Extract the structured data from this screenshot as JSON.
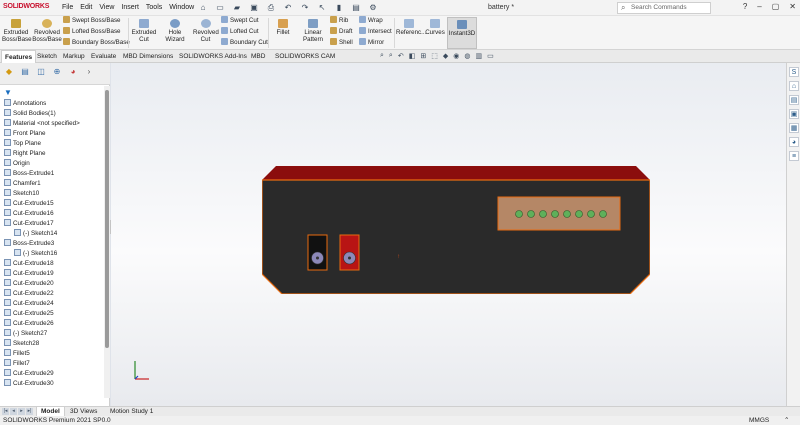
{
  "app": {
    "logo": "SOLIDWORKS",
    "document_title": "battery *"
  },
  "menu": [
    "File",
    "Edit",
    "View",
    "Insert",
    "Tools",
    "Window"
  ],
  "search": {
    "placeholder": "Search Commands"
  },
  "ribbon": {
    "extruded_boss": "Extruded Boss/Base",
    "revolved_boss": "Revolved Boss/Base",
    "swept_boss": "Swept Boss/Base",
    "lofted_boss": "Lofted Boss/Base",
    "boundary_boss": "Boundary Boss/Base",
    "extruded_cut": "Extruded Cut",
    "hole_wizard": "Hole Wizard",
    "revolved_cut": "Revolved Cut",
    "swept_cut": "Swept Cut",
    "lofted_cut": "Lofted Cut",
    "boundary_cut": "Boundary Cut",
    "fillet": "Fillet",
    "linear_pattern": "Linear Pattern",
    "rib": "Rib",
    "draft": "Draft",
    "shell": "Shell",
    "wrap": "Wrap",
    "intersect": "Intersect",
    "mirror": "Mirror",
    "reference": "Referenc...",
    "curves": "Curves",
    "instant3d": "Instant3D"
  },
  "command_tabs": [
    "Features",
    "Sketch",
    "Markup",
    "Evaluate",
    "MBD Dimensions",
    "SOLIDWORKS Add-Ins",
    "MBD",
    "SOLIDWORKS CAM"
  ],
  "feature_tree": [
    "Annotations",
    "Solid Bodies(1)",
    "Material <not specified>",
    "Front Plane",
    "Top Plane",
    "Right Plane",
    "Origin",
    "Boss-Extrude1",
    "Chamfer1",
    "Sketch10",
    "Cut-Extrude15",
    "Cut-Extrude16",
    "Cut-Extrude17",
    "(-) Sketch14",
    "Boss-Extrude3",
    "(-) Sketch16",
    "Cut-Extrude18",
    "Cut-Extrude19",
    "Cut-Extrude20",
    "Cut-Extrude22",
    "Cut-Extrude24",
    "Cut-Extrude25",
    "Cut-Extrude26",
    "(-) Sketch27",
    "Sketch28",
    "Fillet5",
    "Fillet7",
    "Cut-Extrude29",
    "Cut-Extrude30"
  ],
  "bottom_tabs": [
    "Model",
    "3D Views",
    "Motion Study 1"
  ],
  "status": {
    "text": "SOLIDWORKS Premium 2021 SP0.0",
    "units": "MMGS"
  },
  "colors": {
    "body_dark": "#2a2a2a",
    "top_face": "#8b0d0d",
    "edge": "#e86a10",
    "panel_brown": "#b58766",
    "led_green": "#5fb05a",
    "port_red": "#b81414"
  }
}
